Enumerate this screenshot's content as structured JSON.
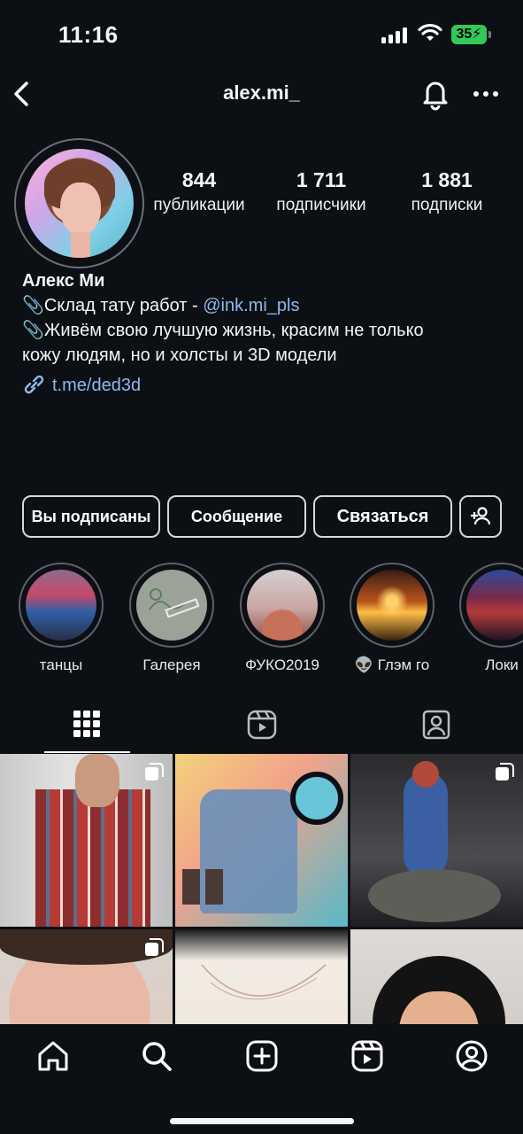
{
  "status_bar": {
    "time": "11:16",
    "battery": "35"
  },
  "header": {
    "username": "alex.mi_"
  },
  "profile": {
    "stats": [
      {
        "value": "844",
        "label": "публикации"
      },
      {
        "value": "1 711",
        "label": "подписчики"
      },
      {
        "value": "1 881",
        "label": "подписки"
      }
    ],
    "name": "Алекс Ми",
    "bio_line1_text": "Склад тату работ  - ",
    "bio_line1_mention": "@ink.mi_pls",
    "bio_line2": "Живём свою лучшую жизнь, красим не только",
    "bio_line3": "кожу людям, но и холсты и 3D модели",
    "link": "t.me/ded3d"
  },
  "buttons": {
    "following": "Вы подписаны",
    "message": "Сообщение",
    "contact": "Связаться"
  },
  "highlights": [
    {
      "label": "танцы"
    },
    {
      "label": "Галерея"
    },
    {
      "label": "ФУКО2019"
    },
    {
      "label": "Глэм го"
    },
    {
      "label": "Локи"
    }
  ],
  "tabs": [
    "grid",
    "reels",
    "tagged"
  ],
  "colors": {
    "background": "#0c0f14",
    "link": "#8fb9ee",
    "battery": "#34c759"
  },
  "icons": {
    "header": [
      "back-arrow-icon",
      "bell-icon",
      "more-icon"
    ],
    "nav": [
      "home-icon",
      "search-icon",
      "create-icon",
      "reels-icon",
      "profile-icon"
    ]
  }
}
